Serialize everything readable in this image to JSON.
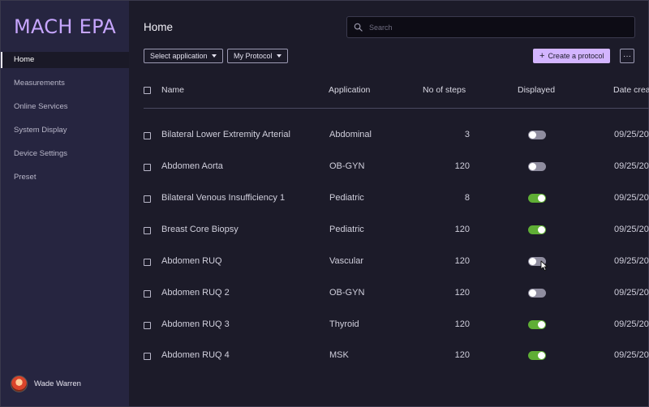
{
  "app": {
    "brand": "MACH EPA"
  },
  "sidebar": {
    "items": [
      {
        "label": "Home",
        "active": true
      },
      {
        "label": "Measurements",
        "active": false
      },
      {
        "label": "Online Services",
        "active": false
      },
      {
        "label": "System Display",
        "active": false
      },
      {
        "label": "Device Settings",
        "active": false
      },
      {
        "label": "Preset",
        "active": false
      }
    ],
    "user": {
      "name": "Wade Warren"
    }
  },
  "header": {
    "title": "Home",
    "search_placeholder": "Search",
    "filter_application": "Select application",
    "filter_protocol": "My Protocol",
    "create_label": "Create a protocol",
    "more_label": "···"
  },
  "table": {
    "columns": {
      "name": "Name",
      "application": "Application",
      "steps": "No of steps",
      "displayed": "Displayed",
      "date": "Date crea"
    },
    "rows": [
      {
        "name": "Bilateral Lower Extremity Arterial",
        "application": "Abdominal",
        "steps": "3",
        "displayed": false,
        "date": "09/25/20"
      },
      {
        "name": "Abdomen Aorta",
        "application": "OB-GYN",
        "steps": "120",
        "displayed": false,
        "date": "09/25/20"
      },
      {
        "name": "Bilateral Venous Insufficiency 1",
        "application": "Pediatric",
        "steps": "8",
        "displayed": true,
        "date": "09/25/20"
      },
      {
        "name": "Breast Core Biopsy",
        "application": "Pediatric",
        "steps": "120",
        "displayed": true,
        "date": "09/25/20"
      },
      {
        "name": "Abdomen RUQ",
        "application": "Vascular",
        "steps": "120",
        "displayed": false,
        "date": "09/25/20"
      },
      {
        "name": "Abdomen RUQ 2",
        "application": "OB-GYN",
        "steps": "120",
        "displayed": false,
        "date": "09/25/20"
      },
      {
        "name": "Abdomen RUQ 3",
        "application": "Thyroid",
        "steps": "120",
        "displayed": true,
        "date": "09/25/20"
      },
      {
        "name": "Abdomen RUQ 4",
        "application": "MSK",
        "steps": "120",
        "displayed": true,
        "date": "09/25/20"
      }
    ]
  },
  "colors": {
    "brand": "#c7a6ff",
    "accent_button": "#d3b5ff",
    "toggle_on": "#5fae35",
    "toggle_off": "#8f8d9f",
    "sidebar_bg": "#262540",
    "main_bg": "#1c1b29"
  },
  "icons": {
    "search": "search-icon",
    "cursor": "pointer-cursor-icon"
  }
}
